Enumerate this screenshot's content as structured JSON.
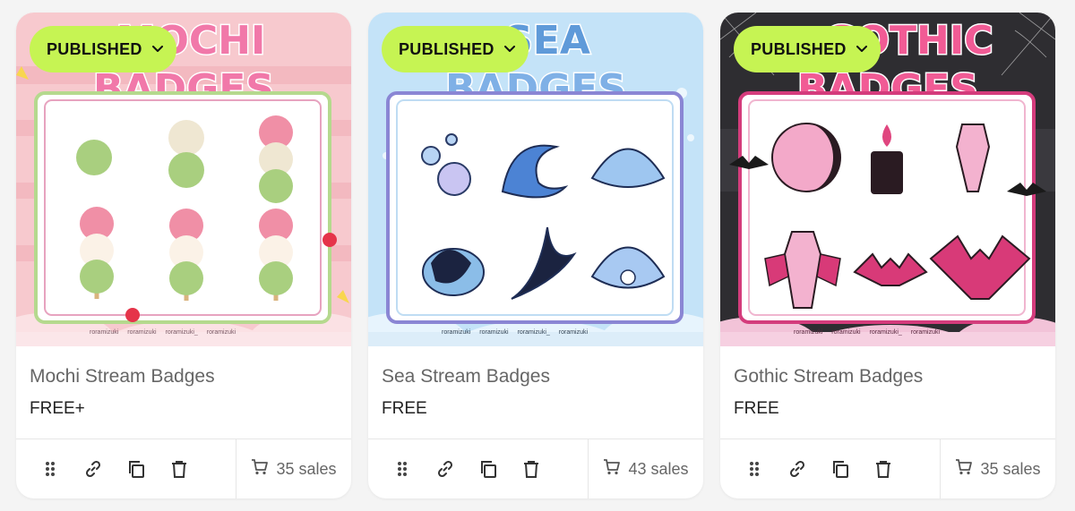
{
  "products": [
    {
      "title": "Mochi Stream Badges",
      "price": "FREE+",
      "status": "PUBLISHED",
      "sales": "35 sales",
      "banner_line1": "MOCHI",
      "banner_line2": "BADGES",
      "theme": {
        "bg": "#f6c6cc",
        "accent": "#e8679a",
        "frame": "#a8d286"
      },
      "social": [
        "roramizuki",
        "roramizuki",
        "roramizuki_",
        "roramizuki"
      ]
    },
    {
      "title": "Sea Stream Badges",
      "price": "FREE",
      "status": "PUBLISHED",
      "sales": "43 sales",
      "banner_line1": "SEA",
      "banner_line2": "BADGES",
      "theme": {
        "bg": "#bfe0f7",
        "accent": "#6c9ed8",
        "frame": "#8a86d4"
      },
      "social": [
        "roramizuki",
        "roramizuki",
        "roramizuki_",
        "roramizuki"
      ]
    },
    {
      "title": "Gothic Stream Badges",
      "price": "FREE",
      "status": "PUBLISHED",
      "sales": "35 sales",
      "banner_line1": "GOTHIC",
      "banner_line2": "BADGES",
      "theme": {
        "bg": "#2c2b2e",
        "accent": "#e0467f",
        "frame": "#d43c7c"
      },
      "social": [
        "roramizuki",
        "roramizuki",
        "roramizuki_",
        "roramizuki"
      ]
    }
  ],
  "icons": {
    "drag": "drag-handle-icon",
    "link": "link-icon",
    "duplicate": "duplicate-icon",
    "delete": "trash-icon",
    "cart": "cart-icon",
    "chevron": "chevron-down-icon"
  }
}
